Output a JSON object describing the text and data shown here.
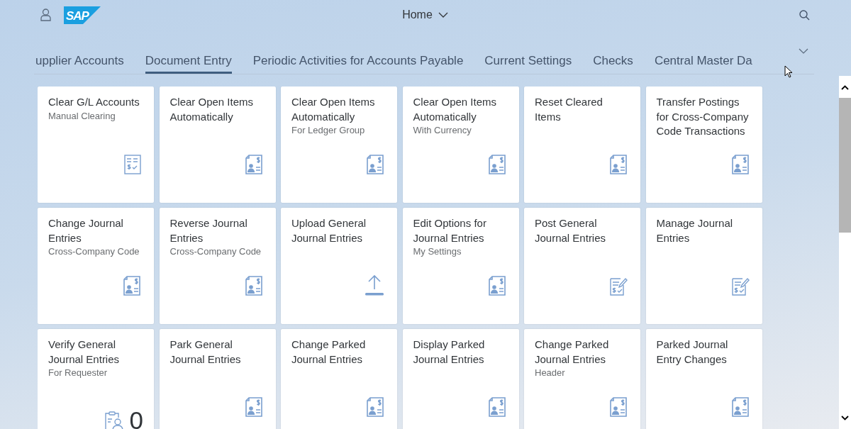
{
  "header": {
    "logo": "SAP",
    "title": "Home"
  },
  "tabs": [
    {
      "label": "upplier Accounts",
      "selected": false
    },
    {
      "label": "Document Entry",
      "selected": true
    },
    {
      "label": "Periodic Activities for Accounts Payable",
      "selected": false
    },
    {
      "label": "Current Settings",
      "selected": false
    },
    {
      "label": "Checks",
      "selected": false
    },
    {
      "label": "Central Master Da",
      "selected": false
    }
  ],
  "tiles": [
    {
      "title": "Clear G/L Accounts",
      "subtitle": "Manual Clearing",
      "kind": "checklist"
    },
    {
      "title": "Clear Open Items Automatically",
      "kind": "invoice"
    },
    {
      "title": "Clear Open Items Automatically",
      "subtitle": "For Ledger Group",
      "kind": "invoice"
    },
    {
      "title": "Clear Open Items Automatically",
      "subtitle": "With Currency",
      "kind": "invoice"
    },
    {
      "title": "Reset Cleared Items",
      "kind": "invoice"
    },
    {
      "title": "Transfer Postings for Cross-Company Code Transactions",
      "kind": "invoice"
    },
    {
      "title": "Change Journal Entries",
      "subtitle": "Cross-Company Code",
      "kind": "invoice"
    },
    {
      "title": "Reverse Journal Entries",
      "subtitle": "Cross-Company Code",
      "kind": "invoice"
    },
    {
      "title": "Upload General Journal Entries",
      "kind": "upload"
    },
    {
      "title": "Edit Options for Journal Entries",
      "subtitle": "My Settings",
      "kind": "invoice"
    },
    {
      "title": "Post General Journal Entries",
      "kind": "edit"
    },
    {
      "title": "Manage Journal Entries",
      "kind": "edit"
    },
    {
      "title": "Verify General Journal Entries",
      "subtitle": "For Requester",
      "kind": "clipboard",
      "count": "0"
    },
    {
      "title": "Park General Journal Entries",
      "kind": "invoice"
    },
    {
      "title": "Change Parked Journal Entries",
      "kind": "invoice"
    },
    {
      "title": "Display Parked Journal Entries",
      "kind": "invoice"
    },
    {
      "title": "Change Parked Journal Entries",
      "subtitle": "Header",
      "kind": "invoice"
    },
    {
      "title": "Parked Journal Entry Changes",
      "kind": "invoice"
    }
  ]
}
